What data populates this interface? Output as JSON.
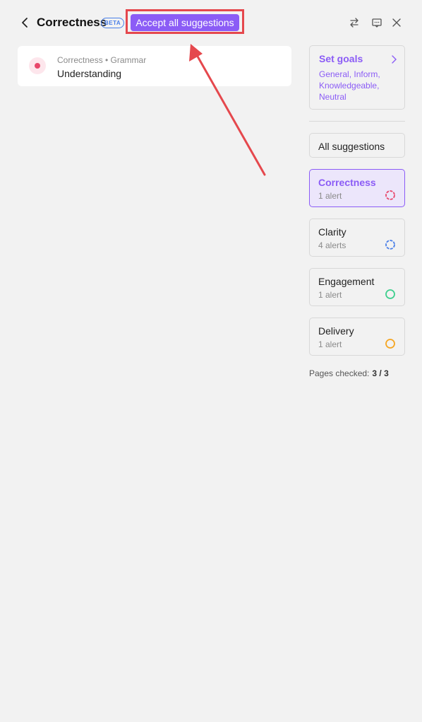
{
  "header": {
    "title": "Correctness",
    "beta_badge": "BETA",
    "accept_all_label": "Accept all suggestions",
    "icons": [
      "back-icon",
      "swap-icon",
      "feedback-icon",
      "close-icon"
    ]
  },
  "suggestion_card": {
    "meta": "Correctness • Grammar",
    "word": "Understanding",
    "dot_color": "#e8476b"
  },
  "sidebar": {
    "goals": {
      "title": "Set goals",
      "description": "General, Inform, Knowledgeable, Neutral"
    },
    "all_suggestions_label": "All suggestions",
    "categories": [
      {
        "name": "Correctness",
        "count": "1 alert",
        "color": "#e8476b",
        "active": true
      },
      {
        "name": "Clarity",
        "count": "4 alerts",
        "color": "#4a7fe8",
        "active": false
      },
      {
        "name": "Engagement",
        "count": "1 alert",
        "color": "#3ecf8e",
        "active": false
      },
      {
        "name": "Delivery",
        "count": "1 alert",
        "color": "#f5a623",
        "active": false
      }
    ],
    "pages_checked_label": "Pages checked:",
    "pages_checked_value": "3 / 3"
  },
  "colors": {
    "accent": "#8b5cf6",
    "annotation": "#e5484d",
    "background": "#f2f2f2"
  }
}
